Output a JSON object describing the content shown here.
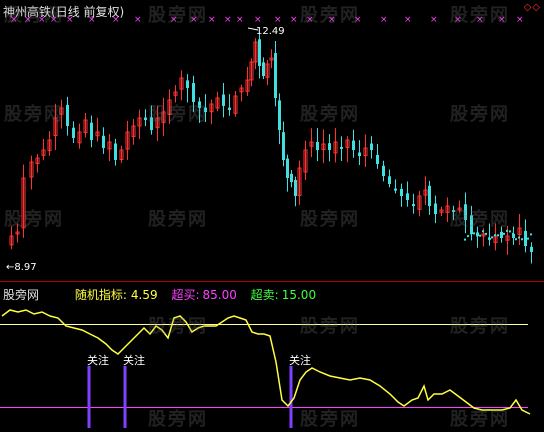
{
  "header": {
    "stock_name": "神州高铁",
    "period": "(日线 前复权)",
    "corner_marks": "◇◇"
  },
  "price_labels": {
    "high": "12.49",
    "low": "←8.97"
  },
  "indicator": {
    "panel_label": "股旁网",
    "name_label": "随机指标:",
    "k_value": "4.59",
    "overbought_label": "超买:",
    "overbought_value": "85.00",
    "oversold_label": "超卖:",
    "oversold_value": "15.00",
    "signal_label": "关注"
  },
  "watermark": "股旁网",
  "colors": {
    "up": "#ff3232",
    "down": "#40e0e0",
    "k_line": "#ffff40",
    "over_line": "#ffffa0",
    "under_line": "#ff40ff",
    "signal": "#8040ff",
    "marker": "#ff40ff"
  },
  "chart_data": {
    "type": "candlestick",
    "price_range": [
      8.97,
      12.49
    ],
    "overbought": 85,
    "oversold": 15,
    "k_last": 4.59
  }
}
